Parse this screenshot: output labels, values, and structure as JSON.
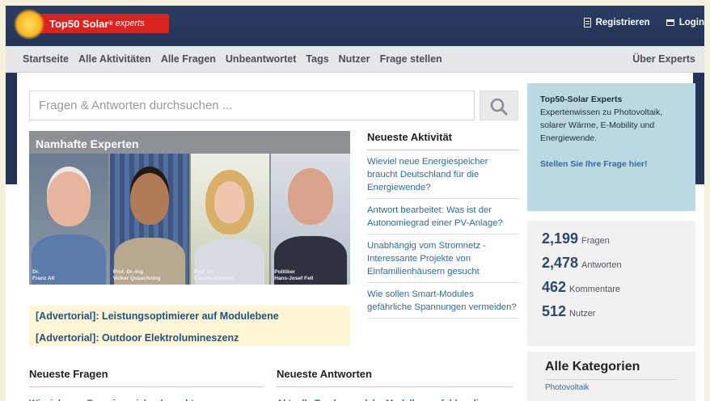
{
  "header": {
    "logo_text": "Top50 Solar",
    "logo_accent": "experts",
    "register_label": "Registrieren",
    "login_label": "Login"
  },
  "nav": {
    "items": [
      "Startseite",
      "Alle Aktivitäten",
      "Alle Fragen",
      "Unbeantwortet",
      "Tags",
      "Nutzer",
      "Frage stellen"
    ],
    "right_label": "Über Experts"
  },
  "search": {
    "placeholder": "Fragen & Antworten durchsuchen ..."
  },
  "experts_banner": {
    "title": "Namhafte Experten",
    "people": [
      {
        "caption_1": "Dr.",
        "caption_2": "Franz Alt"
      },
      {
        "caption_1": "Prof. Dr.-Ing.",
        "caption_2": "Volker Quaschning"
      },
      {
        "caption_1": "Prof. Dr.",
        "caption_2": "Claudia Kemfert"
      },
      {
        "caption_1": "Politiker",
        "caption_2": "Hans-Josef Fell"
      }
    ]
  },
  "activity": {
    "title": "Neueste Aktivität",
    "items": [
      "Wieviel neue Energiespeicher braucht Deutschland für die Energiewende?",
      "Antwort bearbeitet: Was ist der Autonomiegrad einer PV-Anlage?",
      "Unabhängig vom Stromnetz - Interessante Projekte von Einfamilienhäusern gesucht",
      "Wie sollen Smart-Modules gefährliche Spannungen vermeiden?"
    ]
  },
  "adverts": [
    "[Advertorial]: Leistungsoptimierer auf Modulebene",
    "[Advertorial]: Outdoor Elektrolumineszenz"
  ],
  "newest_questions": {
    "title": "Neueste Fragen",
    "items": [
      "Wieviel neue Energiespeicher braucht"
    ]
  },
  "newest_answers": {
    "title": "Neueste Antworten",
    "items": [
      "Aktuelle Tracker: welche Modelle empfehlen die"
    ]
  },
  "promo": {
    "title": "Top50-Solar Experts",
    "text": "Expertenwissen zu Photovoltaik, solarer Wärme, E-Mobility und Energiewende.",
    "link": "Stellen Sie Ihre Frage hier!"
  },
  "stats": [
    {
      "value": "2,199",
      "label": "Fragen"
    },
    {
      "value": "2,478",
      "label": "Antworten"
    },
    {
      "value": "462",
      "label": "Kommentare"
    },
    {
      "value": "512",
      "label": "Nutzer"
    }
  ],
  "categories": {
    "title": "Alle Kategorien",
    "items": [
      "Photovoltaik"
    ]
  },
  "colors": {
    "header_bg": "#243457",
    "brand_red": "#d9231f",
    "link_blue": "#2f6c9e",
    "promo_bg": "#bcd9e3"
  }
}
